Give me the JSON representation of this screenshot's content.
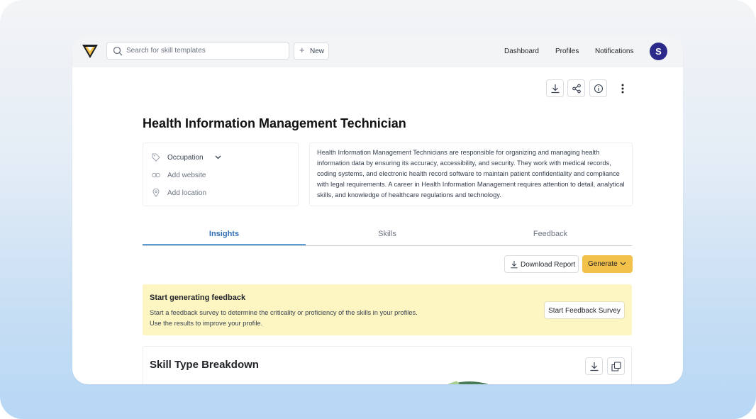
{
  "topbar": {
    "search_placeholder": "Search for skill templates",
    "new_label": "New",
    "nav": [
      "Dashboard",
      "Profiles",
      "Notifications"
    ],
    "avatar_initial": "S"
  },
  "page": {
    "title": "Health Information Management Technician",
    "meta": {
      "category": "Occupation",
      "website": "Add website",
      "location": "Add location"
    },
    "description": "Health Information Management Technicians are responsible for organizing and managing health information data by ensuring its accuracy, accessibility, and security. They work with medical records, coding systems, and electronic health record software to maintain patient confidentiality and compliance with legal requirements. A career in Health Information Management requires attention to detail, analytical skills, and knowledge of healthcare regulations and technology."
  },
  "tabs": [
    {
      "label": "Insights",
      "active": true
    },
    {
      "label": "Skills",
      "active": false
    },
    {
      "label": "Feedback",
      "active": false
    }
  ],
  "actions": {
    "download_report": "Download Report",
    "generate": "Generate"
  },
  "banner": {
    "title": "Start generating feedback",
    "line1": "Start a feedback survey to determine the criticality or proficiency of the skills in your profiles.",
    "line2": "Use the results to improve your profile.",
    "button": "Start Feedback Survey"
  },
  "card": {
    "title": "Skill Type Breakdown"
  },
  "colors": {
    "accent_blue": "#2f6fb5",
    "generate_yellow": "#f2c14a",
    "banner_bg": "#fdf6c3",
    "avatar_bg": "#2b2a8a"
  }
}
